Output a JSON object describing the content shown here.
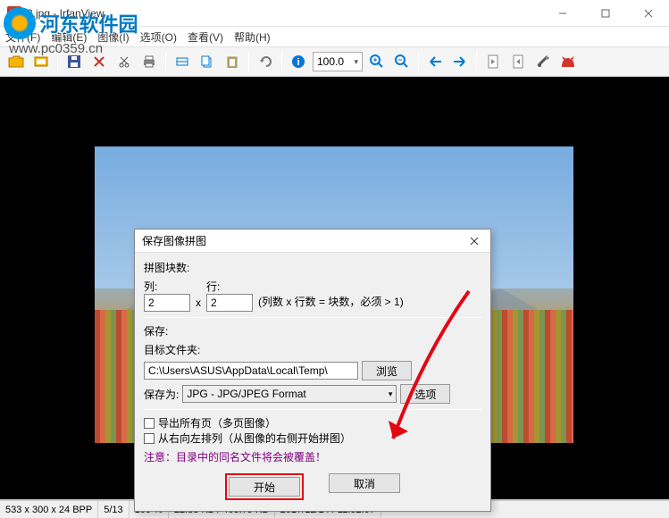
{
  "window": {
    "title": "3.jpg - IrfanView"
  },
  "watermark": {
    "text": "河东软件园",
    "url": "www.pc0359.cn"
  },
  "menubar": {
    "items": [
      {
        "label": "文件(F)"
      },
      {
        "label": "编辑(E)"
      },
      {
        "label": "图像(I)"
      },
      {
        "label": "选项(O)"
      },
      {
        "label": "查看(V)"
      },
      {
        "label": "帮助(H)"
      }
    ]
  },
  "toolbar": {
    "zoom_value": "100.0"
  },
  "dialog": {
    "title": "保存图像拼图",
    "section_blocks": "拼图块数:",
    "label_cols": "列:",
    "label_rows": "行:",
    "cols_value": "2",
    "rows_value": "2",
    "hint_formula": "(列数 x 行数 = 块数，必须 > 1)",
    "section_save": "保存:",
    "label_target_folder": "目标文件夹:",
    "path_value": "C:\\Users\\ASUS\\AppData\\Local\\Temp\\",
    "browse_label": "浏览",
    "label_save_as": "保存为:",
    "format_value": "JPG - JPG/JPEG Format",
    "options_label": "选项",
    "chk_export_all": "导出所有页（多页图像）",
    "chk_rtl": "从右向左排列（从图像的右侧开始拼图）",
    "warn": "注意：目录中的同名文件将会被覆盖！",
    "btn_start": "开始",
    "btn_cancel": "取消"
  },
  "statusbar": {
    "dim": "533 x 300 x 24 BPP",
    "index": "5/13",
    "zoom": "100 %",
    "size": "22.33 KB / 468.79 KB",
    "datetime": "2017/12/14 / 11:52:07"
  }
}
